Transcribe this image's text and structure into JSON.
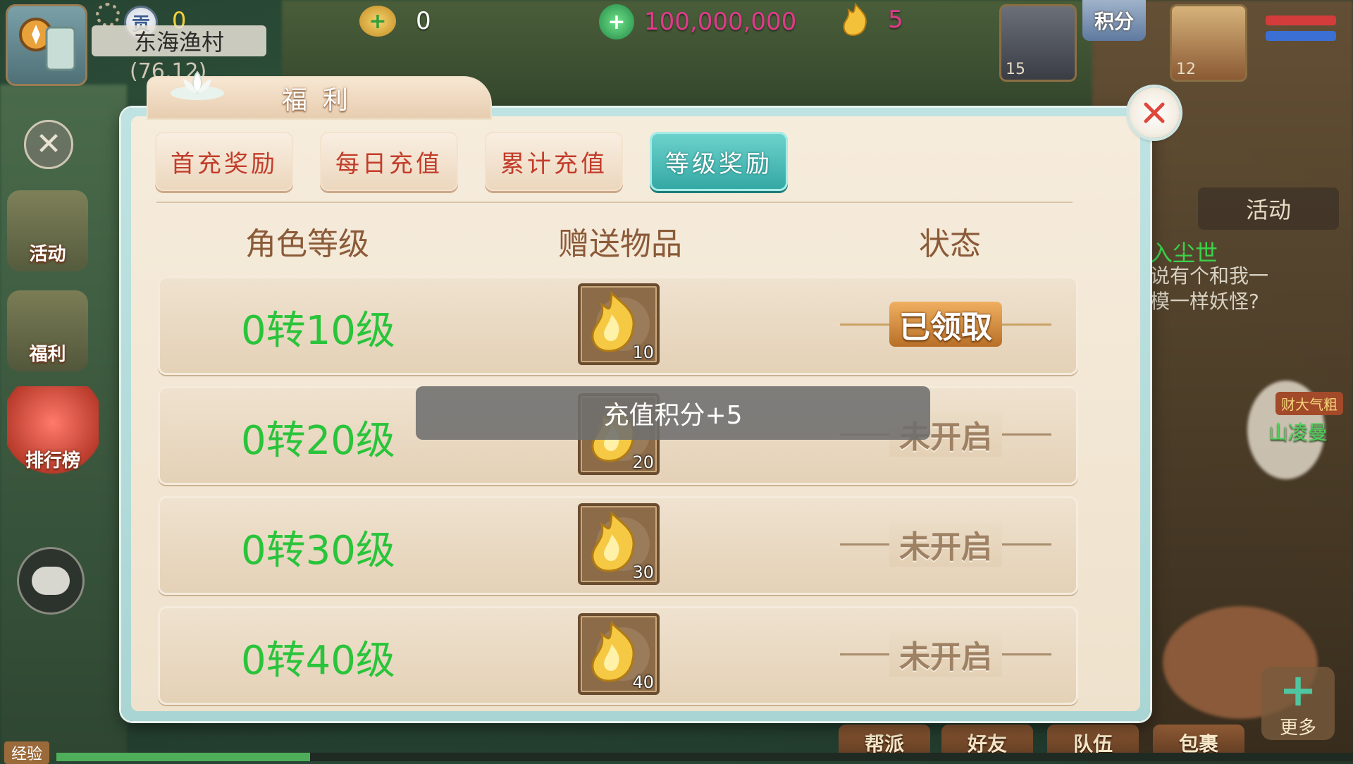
{
  "hud": {
    "player_badge": "贡",
    "player_points": "0",
    "map_name": "东海渔村",
    "coords": "(76,12)",
    "ingot_amount": "0",
    "jade_amount": "100,000,000",
    "flame_amount": "5",
    "score_label": "积分",
    "pet_level": "15",
    "hero_level": "12"
  },
  "left_menu": {
    "activity_label": "活动",
    "welfare_label": "福利",
    "rank_label": "排行榜"
  },
  "right_panel": {
    "tab_activity": "活动",
    "title_text": "入尘世",
    "dialog_text": "说有个和我一模一样妖怪?",
    "npc_tag": "财大气粗",
    "npc_name": "山凌曼",
    "more_label": "更多"
  },
  "bottom_bar": {
    "tabs": [
      "帮派",
      "好友",
      "队伍",
      "包裹"
    ],
    "exp_label": "经验"
  },
  "dialog": {
    "title": "福利",
    "tabs": [
      {
        "label": "首充奖励",
        "active": false
      },
      {
        "label": "每日充值",
        "active": false
      },
      {
        "label": "累计充值",
        "active": false
      },
      {
        "label": "等级奖励",
        "active": true
      }
    ],
    "columns": {
      "level": "角色等级",
      "items": "赠送物品",
      "status": "状态"
    },
    "rows": [
      {
        "level": "0转10级",
        "item_icon": "golden-flame-icon",
        "count": "10",
        "status": "已领取",
        "claimed": true
      },
      {
        "level": "0转20级",
        "item_icon": "golden-flame-icon",
        "count": "20",
        "status": "未开启",
        "claimed": false
      },
      {
        "level": "0转30级",
        "item_icon": "golden-flame-icon",
        "count": "30",
        "status": "未开启",
        "claimed": false
      },
      {
        "level": "0转40级",
        "item_icon": "golden-flame-icon",
        "count": "40",
        "status": "未开启",
        "claimed": false
      }
    ]
  },
  "toast": "充值积分+5",
  "colors": {
    "level_text": "#29c43a",
    "active_tab": "#33a7a3",
    "jade_text": "#e03a8a",
    "points_text": "#f2d23a"
  }
}
